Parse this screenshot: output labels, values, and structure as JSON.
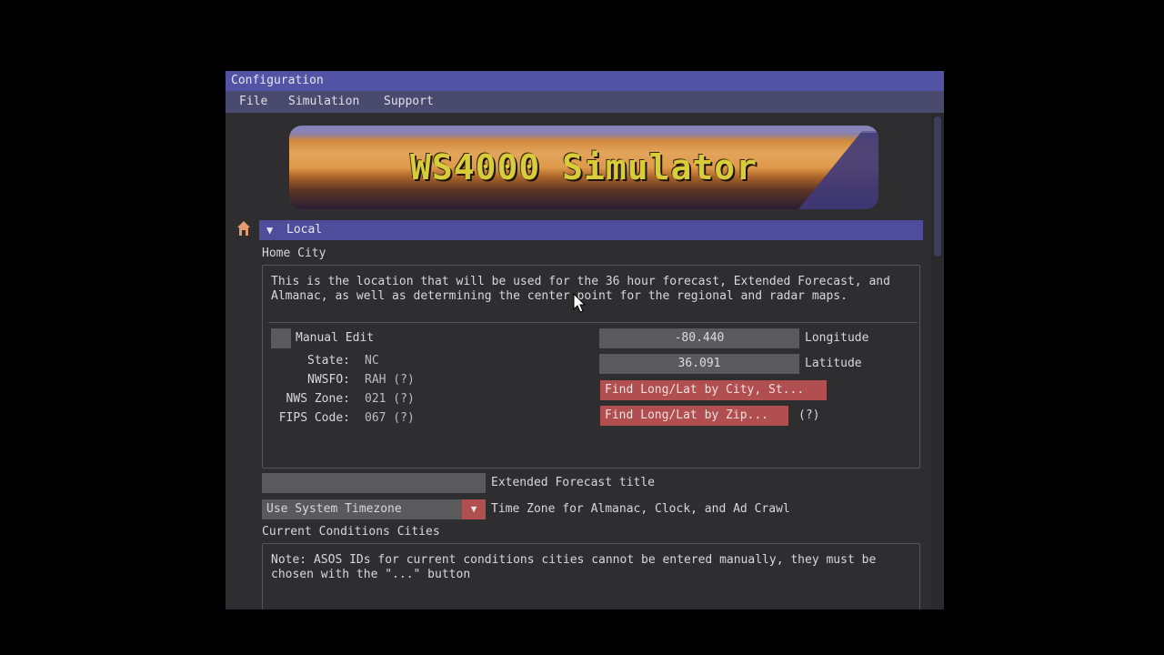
{
  "window": {
    "title": "Configuration"
  },
  "menu": {
    "items": [
      "File",
      "Simulation",
      "Support"
    ]
  },
  "banner": {
    "text": "WS4000 Simulator"
  },
  "local": {
    "header": "Local",
    "home_city_label": "Home City",
    "description": "This is the location that will be used for the 36 hour forecast, Extended Forecast, and Almanac, as well as determining the center point for the regional and radar maps.",
    "manual_edit_label": "Manual Edit",
    "fields": [
      {
        "key": "State:",
        "value": "NC"
      },
      {
        "key": "NWSFO:",
        "value": "RAH (?)"
      },
      {
        "key": "NWS Zone:",
        "value": "021 (?)"
      },
      {
        "key": "FIPS Code:",
        "value": "067 (?)"
      }
    ],
    "longitude_value": "-80.440",
    "longitude_label": "Longitude",
    "latitude_value": "36.091",
    "latitude_label": "Latitude",
    "find_city_button": "Find Long/Lat by City, St...",
    "find_zip_button": "Find Long/Lat by Zip...",
    "zip_help": "(?)",
    "extended_title_label": "Extended Forecast title",
    "extended_title_value": "",
    "timezone_value": "Use System Timezone",
    "timezone_label": "Time Zone for Almanac, Clock, and Ad Crawl",
    "cc_cities_label": "Current Conditions Cities",
    "cc_note": "Note: ASOS IDs for current conditions cities cannot be entered manually, they must be chosen with the \"...\" button"
  },
  "colors": {
    "title_bar": "#5353a6",
    "menu_bar": "#4a4a6e",
    "section_header": "#4d4d9c",
    "button_red": "#b04e50",
    "input_bg": "#5a5a5c",
    "window_bg": "#2e2e30"
  }
}
